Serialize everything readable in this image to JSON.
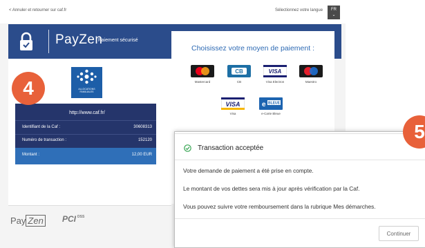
{
  "topbar": {
    "back_link": "< Annuler et retourner sur caf.fr",
    "language_label": "Sélectionnez votre langue",
    "language_button": "FR"
  },
  "header": {
    "brand": "PayZen",
    "secure_label": "Paiement sécurisé",
    "color": "#2b4c8b"
  },
  "merchant": {
    "logo_text": "ALLOCATIONS FAMILIALES",
    "url": "http://www.caf.fr/",
    "rows": [
      {
        "label": "Identifiant de la Caf :",
        "value": "30608313"
      },
      {
        "label": "Numéro de transaction :",
        "value": "152120"
      }
    ],
    "amount_label": "Montant :",
    "amount_value": "12,00 EUR"
  },
  "payment": {
    "title": "Choisissez votre moyen de paiement :",
    "methods": [
      {
        "label": "Mastercard",
        "icon": "mastercard-icon"
      },
      {
        "label": "CB",
        "icon": "cb-icon"
      },
      {
        "label": "Visa Electron",
        "icon": "visa-electron-icon"
      },
      {
        "label": "Maestro",
        "icon": "maestro-icon"
      },
      {
        "label": "Visa",
        "icon": "visa-icon"
      },
      {
        "label": "e-Carte Bleue",
        "icon": "e-carte-bleue-icon"
      }
    ]
  },
  "footer": {
    "payzen_pay": "Pay",
    "payzen_zen": "Zen",
    "pci": "PCI DSS"
  },
  "badges": {
    "step_left": "4",
    "step_right": "5",
    "color": "#e8613a"
  },
  "dialog": {
    "title": "Transaction acceptée",
    "line1": "Votre demande de paiement a été prise en compte.",
    "line2": "Le montant de vos dettes sera mis à jour après vérification par la Caf.",
    "line3": "Vous pouvez suivre votre remboursement dans la rubrique Mes démarches.",
    "continue": "Continuer",
    "check_color": "#3aa655"
  }
}
